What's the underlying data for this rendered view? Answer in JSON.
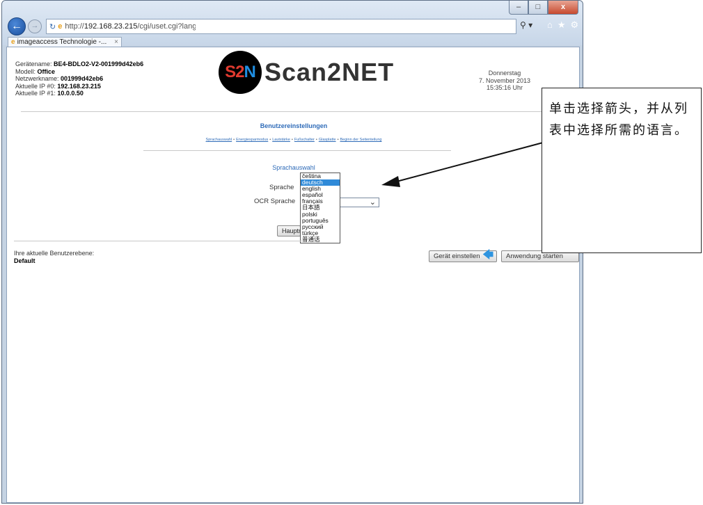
{
  "browser": {
    "address_prefix": "http://",
    "address_host": "192.168.23.215",
    "address_path": "/cgi/uset.cgi?language",
    "tab_title": "imageaccess Technologie -...",
    "caption_buttons": {
      "minimize": "–",
      "maximize": "□",
      "close": "x"
    },
    "icons": [
      "back-icon",
      "forward-icon",
      "refresh-icon",
      "ie-icon",
      "search-icon",
      "home-icon",
      "favorites-star-icon",
      "settings-gear-icon"
    ]
  },
  "device": {
    "name_label": "Gerätename: ",
    "name_value": "BE4-BDLO2-V2-001999d42eb6",
    "model_label": "Modell: ",
    "model_value": "Office",
    "netname_label": "Netzwerkname: ",
    "netname_value": "001999d42eb6",
    "ip0_label": "Aktuelle IP #0: ",
    "ip0_value": "192.168.23.215",
    "ip1_label": "Aktuelle IP #1: ",
    "ip1_value": "10.0.0.50"
  },
  "logo": {
    "mark_s2": "S2",
    "mark_n": "N",
    "text": "Scan2NET"
  },
  "datetime": {
    "day": "Donnerstag",
    "date": "7. November 2013",
    "time": "15:35:16 Uhr"
  },
  "page": {
    "title": "Benutzereinstellungen",
    "subnav": [
      "Sprachauswahl",
      "Energiesparmodus",
      "Lautstärke",
      "Fußschalter",
      "Glasplatte",
      "Beginn der Seitenteilung"
    ],
    "section_title": "Sprachauswahl",
    "language_label": "Sprache",
    "ocr_label": "OCR Sprache",
    "main_button_label": "Hauptmenü",
    "user_level_label": "Ihre aktuelle Benutzerebene:",
    "user_level_value": "Default",
    "device_button_label": "Gerät einstellen",
    "app_button_label": "Anwendung starten"
  },
  "language_options": [
    "čeština",
    "deutsch",
    "english",
    "español",
    "français",
    "日本語",
    "polski",
    "português",
    "русский",
    "türkçe",
    "普通话"
  ],
  "language_selected": "deutsch",
  "callout": {
    "text": "单击选择箭头，并从列表中选择所需的语言。"
  },
  "colors": {
    "link": "#2e6bb8",
    "selection": "#2f8ad8",
    "logo_red": "#e03a2f",
    "logo_blue": "#1f8de0"
  }
}
